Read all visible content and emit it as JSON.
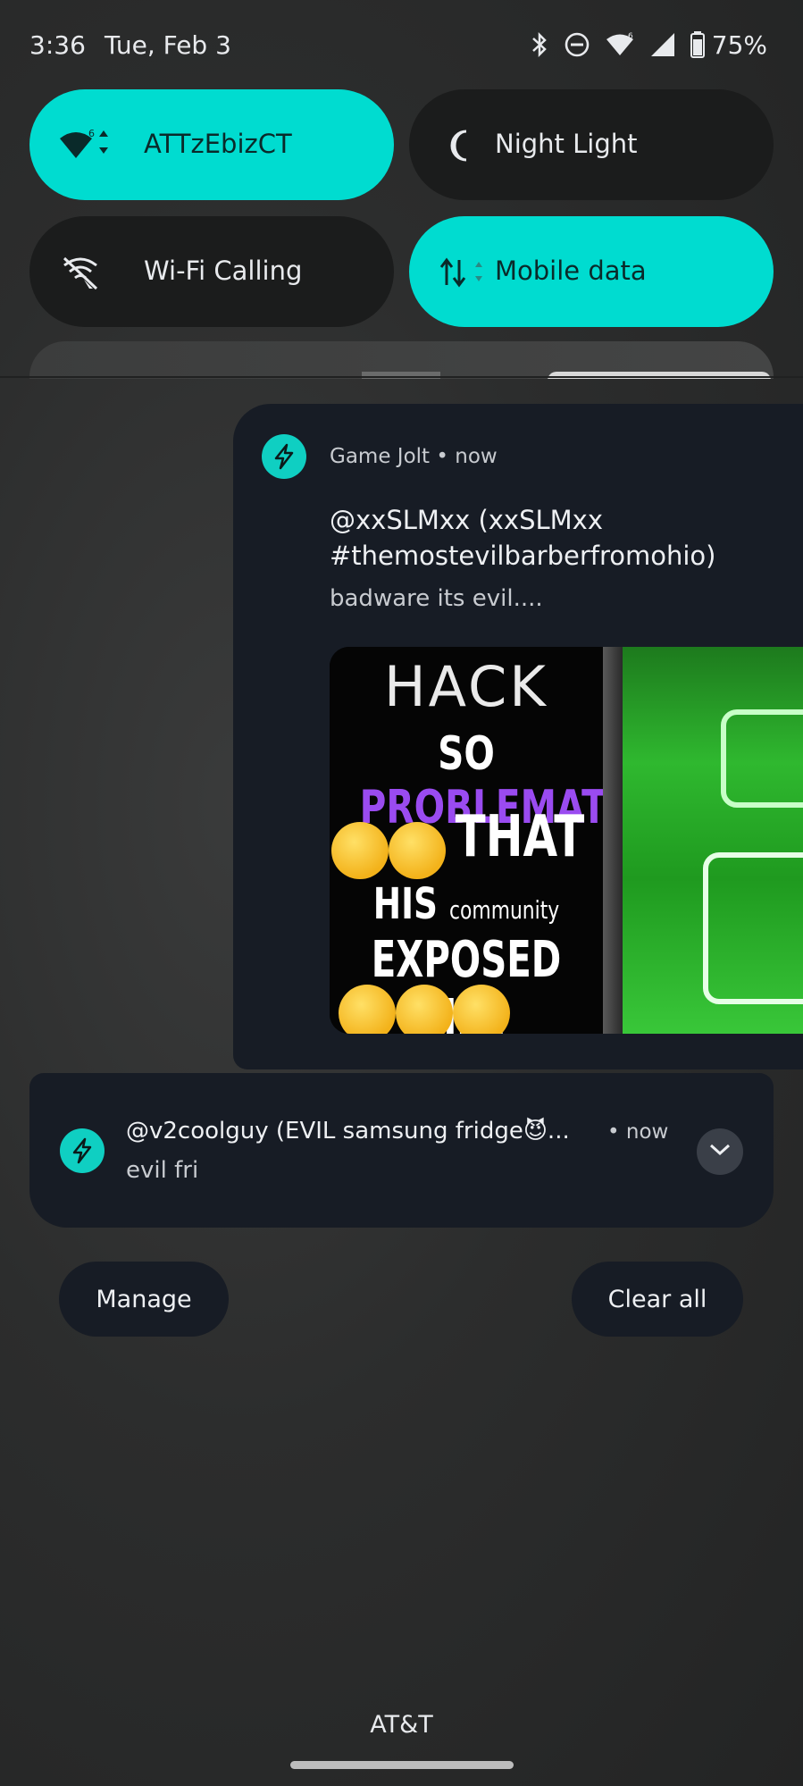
{
  "status_bar": {
    "time": "3:36",
    "date": "Tue, Feb 3",
    "battery": "75%",
    "icons": [
      "bluetooth-icon",
      "dnd-icon",
      "wifi-icon",
      "signal-icon",
      "battery-icon"
    ]
  },
  "quick_tiles": [
    {
      "label": "ATTzEbizCT",
      "icon": "wifi-icon",
      "active": true
    },
    {
      "label": "Night Light",
      "icon": "moon-icon",
      "active": false
    },
    {
      "label": "Wi-Fi Calling",
      "icon": "wifi-calling-off-icon",
      "active": false
    },
    {
      "label": "Mobile data",
      "icon": "mobile-data-icon",
      "active": true
    }
  ],
  "colors": {
    "accent": "#00dcd0",
    "card": "#171c25",
    "background": "#2a2b2b"
  },
  "notifications": [
    {
      "app": "Game Jolt",
      "separator": "•",
      "time": "now",
      "title": "@xxSLMxx (xxSLMxx #themostevilbarberfromohio)",
      "body": "badware its evil....",
      "image_text": {
        "line1": "HACK",
        "line2a": "SO",
        "line2b": "PROBLEMATIC",
        "line3": "THAT",
        "line4a": "HIS",
        "line4b": "community",
        "line5": "EXPOSED HIM"
      }
    },
    {
      "title": "@v2coolguy (EVIL samsung fridge😈...",
      "time": "• now",
      "body": "evil fri"
    }
  ],
  "actions": {
    "manage": "Manage",
    "clear_all": "Clear all"
  },
  "carrier": "AT&T"
}
